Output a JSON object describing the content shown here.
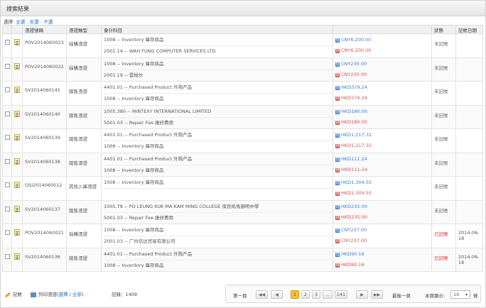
{
  "panel": {
    "title": "搜索結果",
    "select_label": "選擇:",
    "select_all": "全選",
    "select_sep1": "-",
    "select_invert": "反選",
    "select_sep2": "-",
    "select_none": "不選"
  },
  "table": {
    "headers": [
      "",
      "",
      "憑證號碼",
      "憑證類型",
      "會計科目",
      "",
      "狀態",
      "記賬日期"
    ],
    "rows": [
      {
        "voucher": "POV2014060023",
        "type": "採購憑證",
        "lines": [
          {
            "acct": "1008 -- Inventory 庫存商品",
            "amt": "CNY6,200.00",
            "side": "dr"
          },
          {
            "acct": "2001.14 -- WAH FUNG COMPUTER SERVICES LTD",
            "amt": "CNY6,200.00",
            "side": "cr"
          }
        ],
        "status": "未記賬",
        "date": ""
      },
      {
        "voucher": "POV2014060022",
        "type": "採購憑證",
        "lines": [
          {
            "acct": "1008 -- Inventory 庫存商品",
            "amt": "CNY230.00",
            "side": "dr"
          },
          {
            "acct": "2001.19 -- 雲柏尔",
            "amt": "CNY230.00",
            "side": "cr"
          }
        ],
        "status": "未記賬",
        "date": ""
      },
      {
        "voucher": "SV2014060141",
        "type": "銷售憑證",
        "lines": [
          {
            "acct": "4401.01 -- Purchased Product 外购产品",
            "amt": "HKD379.24",
            "side": "dr"
          },
          {
            "acct": "1008 -- Inventory 庫存商品",
            "amt": "HKD379.24",
            "side": "cr"
          }
        ],
        "status": "未記賬",
        "date": ""
      },
      {
        "voucher": "SV2014060140",
        "type": "銷售憑證",
        "lines": [
          {
            "acct": "1005.380 -- MINTEXY INTERNATIONAL LIMITED",
            "amt": "HKD180.00",
            "side": "dr"
          },
          {
            "acct": "5001.03 -- Repair Fee 維修費用",
            "amt": "HKD180.00",
            "side": "cr"
          }
        ],
        "status": "未記賬",
        "date": ""
      },
      {
        "voucher": "SV2014060139",
        "type": "銷售憑證",
        "lines": [
          {
            "acct": "4401.01 -- Purchased Product 外购产品",
            "amt": "HKD1,217.32",
            "side": "dr"
          },
          {
            "acct": "1008 -- Inventory 庫存商品",
            "amt": "HKD1,217.32",
            "side": "cr"
          }
        ],
        "status": "未記賬",
        "date": ""
      },
      {
        "voucher": "SV2014060138",
        "type": "銷售憑證",
        "lines": [
          {
            "acct": "4401.01 -- Purchased Product 外购产品",
            "amt": "HKD111.24",
            "side": "dr"
          },
          {
            "acct": "1008 -- Inventory 庫存商品",
            "amt": "HKD111.24",
            "side": "cr"
          }
        ],
        "status": "未記賬",
        "date": ""
      },
      {
        "voucher": "OSI2014060012",
        "type": "其他入庫憑證",
        "lines": [
          {
            "acct": "1008 -- Inventory 庫存商品",
            "amt": "HKD1,304.55",
            "side": "dr"
          },
          {
            "acct": "",
            "amt": "HKD1,304.55",
            "side": "cr"
          }
        ],
        "status": "未記賬",
        "date": ""
      },
      {
        "voucher": "SV2014060137",
        "type": "銷售憑證",
        "lines": [
          {
            "acct": "1005.78 -- PO LEUNG KUK MA KAM MING COLLEGE 保良局馬錦明中學",
            "amt": "HKD235.00",
            "side": "dr"
          },
          {
            "acct": "5001.03 -- Repair Fee 維修費用",
            "amt": "HKD235.00",
            "side": "cr"
          }
        ],
        "status": "未記賬",
        "date": ""
      },
      {
        "voucher": "POV2014060021",
        "type": "採購憑證",
        "lines": [
          {
            "acct": "1008 -- Inventory 庫存商品",
            "amt": "CNY237.00",
            "side": "dr"
          },
          {
            "acct": "2001.03 -- 广州信达贸易有限公司",
            "amt": "CNY237.00",
            "side": "cr"
          }
        ],
        "status": "已記賬",
        "date": "2014-06-18"
      },
      {
        "voucher": "SV2014060136",
        "type": "銷售憑證",
        "lines": [
          {
            "acct": "4401.01 -- Purchased Product 外购产品",
            "amt": "HKD90.16",
            "side": "dr"
          },
          {
            "acct": "1008 -- Inventory 庫存商品",
            "amt": "HKD90.16",
            "side": "cr"
          }
        ],
        "status": "已記賬",
        "date": "2014-06-18"
      }
    ],
    "dr_tag": "借",
    "cr_tag": "貸"
  },
  "footer": {
    "post_label": "記賬",
    "print_label": "列印憑證(",
    "print_select": "選擇",
    "print_sep": " / ",
    "print_all": "全部",
    "print_close": ")",
    "record_count": "記錄：1409",
    "first_page": "第一頁",
    "last_page": "最後一頁",
    "pages": [
      "1",
      "2",
      "3",
      "...",
      "141"
    ],
    "current_page": "1",
    "per_page_label": "本頁顯示:",
    "per_page_value": "10",
    "per_page_unit": "條"
  },
  "colors": {
    "debit": "#3c7fd0",
    "credit": "#d9534f",
    "posted": "#e02a2a",
    "active_page": "#f2c33b"
  }
}
